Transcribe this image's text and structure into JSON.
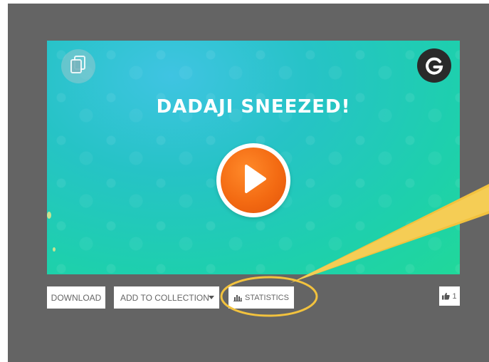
{
  "video": {
    "title": "DADAJI SNEEZED!",
    "badge_letter": "G"
  },
  "actions": {
    "download_label": "DOWNLOAD",
    "collection_label": "ADD TO COLLECTION",
    "statistics_label": "STATISTICS",
    "like_count": "1"
  },
  "colors": {
    "frame": "#646464",
    "highlight": "#f2c23e",
    "play": "#f36a12"
  },
  "icons": [
    "copy-icon",
    "g-logo-icon",
    "play-icon",
    "bar-chart-icon",
    "thumbs-up-icon",
    "chevron-down-icon"
  ]
}
